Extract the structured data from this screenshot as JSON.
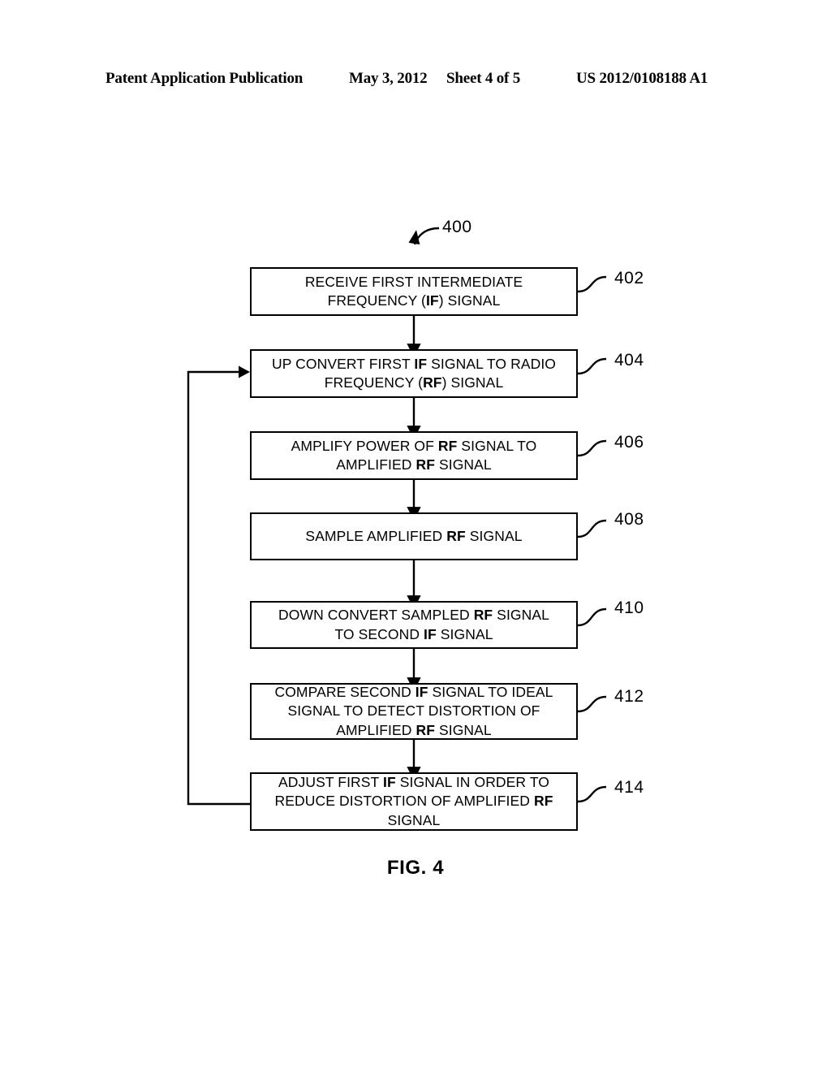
{
  "header": {
    "publication": "Patent Application Publication",
    "date": "May 3, 2012",
    "sheet": "Sheet 4 of 5",
    "doc_number": "US 2012/0108188 A1"
  },
  "figure": {
    "caption": "FIG. 4",
    "diagram_ref": "400",
    "type": "flowchart",
    "boxes": [
      {
        "ref": "402",
        "lines": [
          "RECEIVE FIRST INTERMEDIATE",
          "FREQUENCY (IF) SIGNAL"
        ],
        "html": "RECEIVE FIRST INTERMEDIATE<br>FREQUENCY (<b>IF</b>) SIGNAL",
        "plain": "RECEIVE FIRST INTERMEDIATE FREQUENCY (IF) SIGNAL"
      },
      {
        "ref": "404",
        "lines": [
          "UP CONVERT FIRST IF SIGNAL TO RADIO",
          "FREQUENCY (RF) SIGNAL"
        ],
        "html": "UP CONVERT FIRST <b>IF</b> SIGNAL TO RADIO<br>FREQUENCY (<b>RF</b>) SIGNAL",
        "plain": "UP CONVERT FIRST IF SIGNAL TO RADIO FREQUENCY (RF) SIGNAL"
      },
      {
        "ref": "406",
        "lines": [
          "AMPLIFY POWER OF RF SIGNAL TO",
          "AMPLIFIED RF SIGNAL"
        ],
        "html": "AMPLIFY POWER OF <b>RF</b> SIGNAL TO<br>AMPLIFIED <b>RF</b> SIGNAL",
        "plain": "AMPLIFY POWER OF RF SIGNAL TO AMPLIFIED RF SIGNAL"
      },
      {
        "ref": "408",
        "lines": [
          "SAMPLE AMPLIFIED RF SIGNAL"
        ],
        "html": "SAMPLE AMPLIFIED <b>RF</b> SIGNAL",
        "plain": "SAMPLE AMPLIFIED RF SIGNAL"
      },
      {
        "ref": "410",
        "lines": [
          "DOWN CONVERT SAMPLED RF SIGNAL",
          "TO SECOND IF SIGNAL"
        ],
        "html": "DOWN CONVERT SAMPLED <b>RF</b> SIGNAL<br>TO SECOND <b>IF</b> SIGNAL",
        "plain": "DOWN CONVERT SAMPLED RF SIGNAL TO SECOND IF SIGNAL"
      },
      {
        "ref": "412",
        "lines": [
          "COMPARE SECOND IF SIGNAL TO IDEAL",
          "SIGNAL TO DETECT DISTORTION OF",
          "AMPLIFIED RF SIGNAL"
        ],
        "html": "COMPARE SECOND <b>IF</b> SIGNAL TO IDEAL<br>SIGNAL TO DETECT DISTORTION OF<br>AMPLIFIED <b>RF</b> SIGNAL",
        "plain": "COMPARE SECOND IF SIGNAL TO IDEAL SIGNAL TO DETECT DISTORTION OF AMPLIFIED RF SIGNAL"
      },
      {
        "ref": "414",
        "lines": [
          "ADJUST FIRST IF SIGNAL IN ORDER TO",
          "REDUCE DISTORTION OF AMPLIFIED RF",
          "SIGNAL"
        ],
        "html": "ADJUST FIRST <b>IF</b> SIGNAL IN ORDER TO<br>REDUCE DISTORTION OF AMPLIFIED <b>RF</b><br>SIGNAL",
        "plain": "ADJUST FIRST IF SIGNAL IN ORDER TO REDUCE DISTORTION OF AMPLIFIED RF SIGNAL"
      }
    ],
    "connectors": [
      {
        "from": "402",
        "to": "404",
        "kind": "arrow-down"
      },
      {
        "from": "404",
        "to": "406",
        "kind": "arrow-down"
      },
      {
        "from": "406",
        "to": "408",
        "kind": "arrow-down"
      },
      {
        "from": "408",
        "to": "410",
        "kind": "arrow-down"
      },
      {
        "from": "410",
        "to": "412",
        "kind": "arrow-down"
      },
      {
        "from": "412",
        "to": "414",
        "kind": "arrow-down"
      },
      {
        "from": "414",
        "to": "404",
        "kind": "feedback-loop-left"
      }
    ],
    "colors": {
      "ink": "#000000",
      "paper": "#ffffff"
    }
  }
}
